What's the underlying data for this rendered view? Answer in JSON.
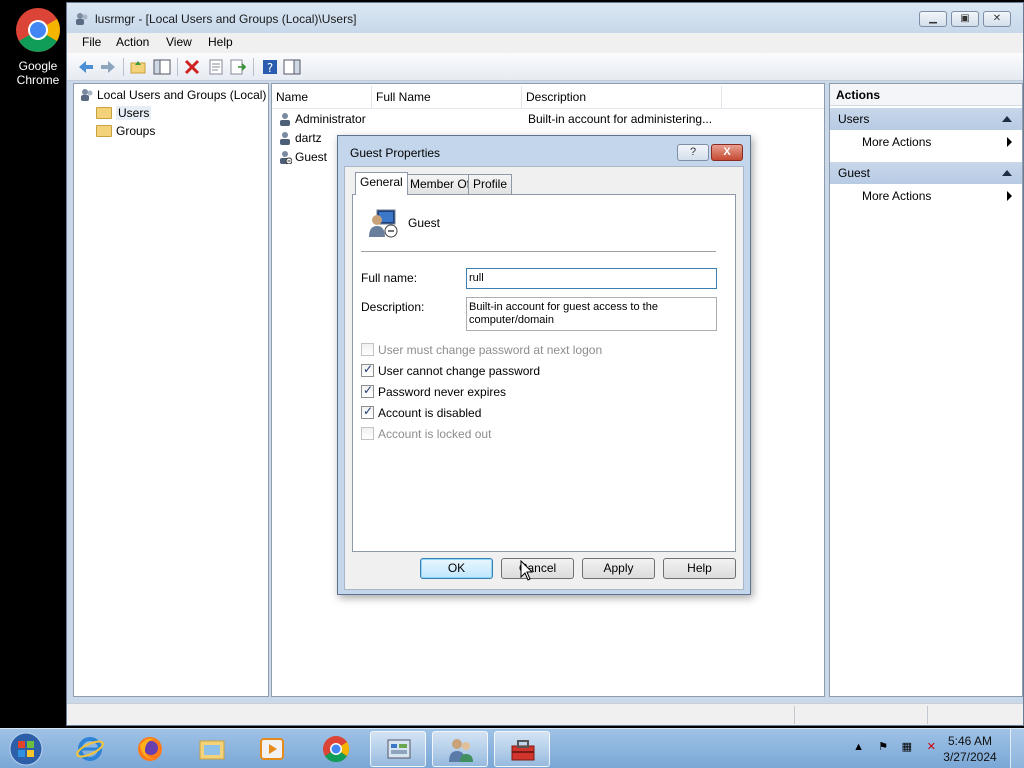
{
  "desktop": {
    "icon_label_line1": "Google",
    "icon_label_line2": "Chrome"
  },
  "window": {
    "title": "lusrmgr - [Local Users and Groups (Local)\\Users]",
    "menu": [
      "File",
      "Action",
      "View",
      "Help"
    ]
  },
  "tree": {
    "root": "Local Users and Groups (Local)",
    "children": [
      "Users",
      "Groups"
    ],
    "selected": "Users"
  },
  "list": {
    "columns": [
      "Name",
      "Full Name",
      "Description"
    ],
    "rows": [
      {
        "name": "Administrator",
        "full_name": "",
        "description": "Built-in account for administering..."
      },
      {
        "name": "dartz",
        "full_name": "",
        "description": ""
      },
      {
        "name": "Guest",
        "full_name": "",
        "description": ""
      }
    ]
  },
  "actions": {
    "title": "Actions",
    "sections": [
      {
        "header": "Users",
        "item": "More Actions"
      },
      {
        "header": "Guest",
        "item": "More Actions"
      }
    ]
  },
  "dialog": {
    "title": "Guest Properties",
    "help_glyph": "?",
    "close_glyph": "X",
    "tabs": [
      "General",
      "Member Of",
      "Profile"
    ],
    "active_tab": "General",
    "user_name": "Guest",
    "full_name_label": "Full name:",
    "full_name_value": "rull",
    "description_label": "Description:",
    "description_line1": "Built-in account for guest access to the",
    "description_line2": "computer/domain",
    "checkboxes": [
      {
        "label": "User must change password at next logon",
        "checked": false,
        "enabled": false
      },
      {
        "label": "User cannot change password",
        "checked": true,
        "enabled": true
      },
      {
        "label": "Password never expires",
        "checked": true,
        "enabled": true
      },
      {
        "label": "Account is disabled",
        "checked": true,
        "enabled": true
      },
      {
        "label": "Account is locked out",
        "checked": false,
        "enabled": false
      }
    ],
    "buttons": {
      "ok": "OK",
      "cancel": "Cancel",
      "apply": "Apply",
      "help": "Help"
    }
  },
  "taskbar": {
    "time": "5:46 AM",
    "date": "3/27/2024"
  }
}
